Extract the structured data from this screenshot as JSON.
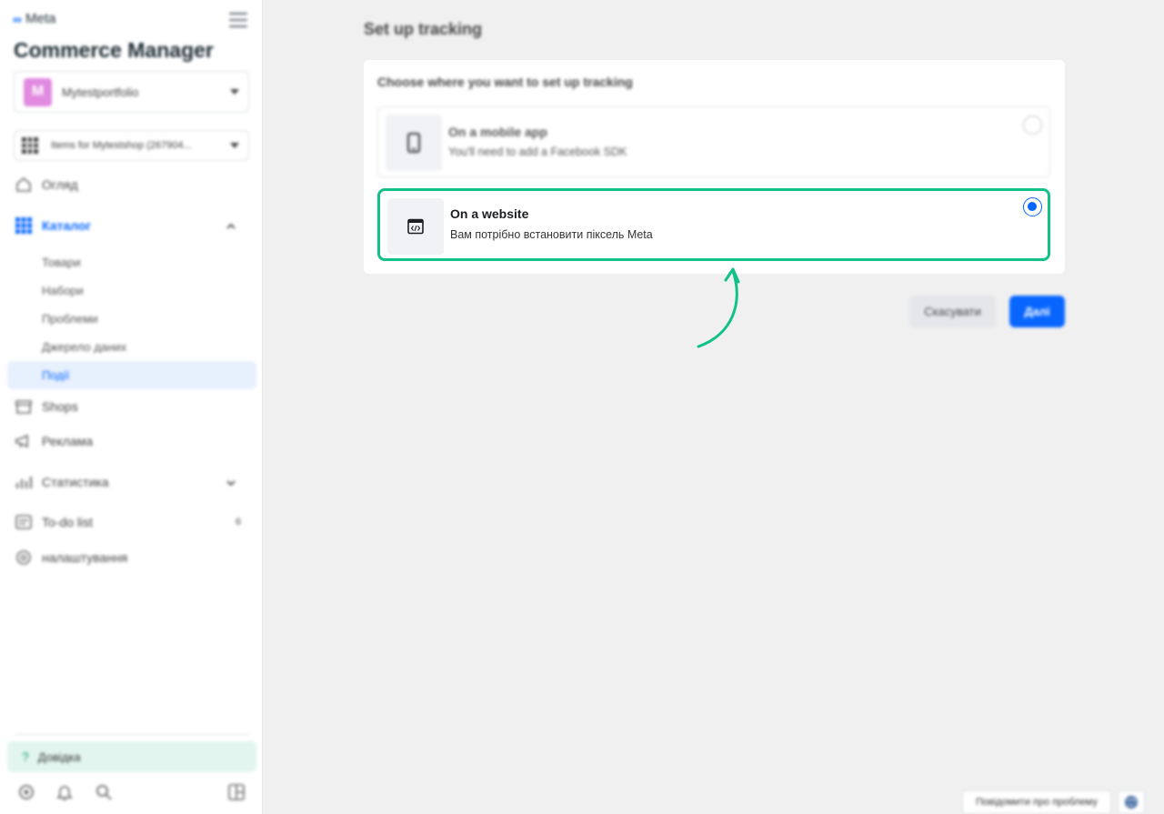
{
  "sidebar": {
    "brand": "Meta",
    "app_title": "Commerce Manager",
    "account": {
      "initial": "M",
      "name": "Mytestportfolio",
      "avatar_color": "#e18ae0"
    },
    "catalog_selector": {
      "name": "Items for Mytestshop (267904..."
    },
    "nav": [
      {
        "label": "Огляд",
        "icon": "home-icon"
      },
      {
        "label": "Каталог",
        "icon": "grid-icon",
        "active": true
      },
      {
        "label": "Shops",
        "icon": "store-icon"
      },
      {
        "label": "Реклама",
        "icon": "megaphone-icon"
      },
      {
        "label": "Статистика",
        "icon": "bar-chart-icon"
      },
      {
        "label": "To-do list",
        "icon": "checklist-icon",
        "badge": "6"
      },
      {
        "label": "налаштування",
        "icon": "gear-icon"
      }
    ],
    "catalog_sub": [
      {
        "label": "Товари"
      },
      {
        "label": "Набори"
      },
      {
        "label": "Проблеми"
      },
      {
        "label": "Джерело даних"
      },
      {
        "label": "Події",
        "active": true
      }
    ],
    "help_label": "Довідка",
    "bottom_icons": [
      "settings-icon",
      "bell-icon",
      "search-icon",
      "layout-icon"
    ]
  },
  "main": {
    "page_title": "Set up tracking",
    "card_heading": "Choose where you want to set up tracking",
    "options": [
      {
        "title": "On a mobile app",
        "description": "You'll need to add a Facebook SDK",
        "icon": "phone-icon",
        "selected": false
      },
      {
        "title": "On a website",
        "description": "Вам потрібно встановити піксель Meta",
        "icon": "code-window-icon",
        "selected": true
      }
    ],
    "cancel_label": "Скасувати",
    "next_label": "Далі",
    "report_label": "Повідомити про проблему"
  },
  "colors": {
    "accent": "#0866ff",
    "highlight": "#12c08a"
  }
}
